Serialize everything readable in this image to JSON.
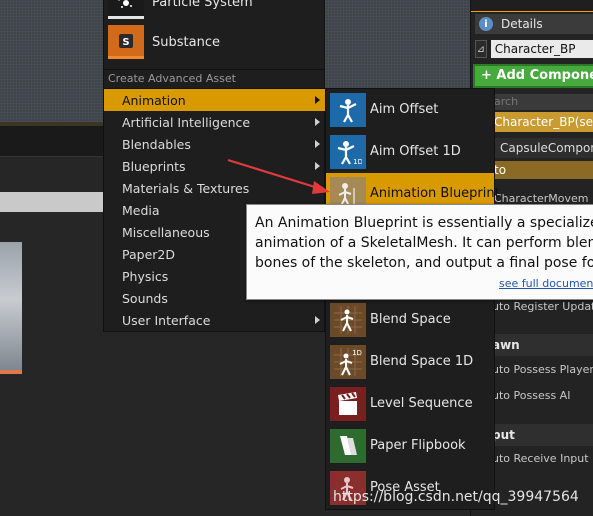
{
  "top_menu": {
    "items": [
      {
        "label": "Particle System",
        "icon": "particle-system-icon"
      },
      {
        "label": "Substance",
        "icon": "substance-icon"
      }
    ],
    "section_label": "Create Advanced Asset"
  },
  "advanced_menu": {
    "items": [
      {
        "label": "Animation",
        "selected": true
      },
      {
        "label": "Artificial Intelligence"
      },
      {
        "label": "Blendables"
      },
      {
        "label": "Blueprints"
      },
      {
        "label": "Materials & Textures"
      },
      {
        "label": "Media"
      },
      {
        "label": "Miscellaneous"
      },
      {
        "label": "Paper2D"
      },
      {
        "label": "Physics"
      },
      {
        "label": "Sounds"
      },
      {
        "label": "User Interface"
      }
    ]
  },
  "animation_submenu": {
    "items": [
      {
        "label": "Aim Offset",
        "icon": "aim-offset-icon"
      },
      {
        "label": "Aim Offset 1D",
        "icon": "aim-offset-1d-icon"
      },
      {
        "label": "Animation Blueprint",
        "icon": "animation-blueprint-icon",
        "highlighted": true
      },
      {
        "label": "Blend Space",
        "icon": "blend-space-icon"
      },
      {
        "label": "Blend Space 1D",
        "icon": "blend-space-1d-icon"
      },
      {
        "label": "Level Sequence",
        "icon": "level-sequence-icon"
      },
      {
        "label": "Paper Flipbook",
        "icon": "paper-flipbook-icon"
      },
      {
        "label": "Pose Asset",
        "icon": "pose-asset-icon"
      }
    ]
  },
  "tooltip": {
    "lines": [
      "An Animation Blueprint is essentially a specialize",
      "animation of a SkeletalMesh. It can perform blend",
      "bones of the skeleton, and output a final pose for"
    ],
    "link": "see full documenta"
  },
  "details": {
    "title": "Details",
    "object_name": "Character_BP",
    "add_component": "+ Add Componen",
    "search_placeholder": "arch",
    "self_row": "Character_BP(self",
    "capsule_row": "CapsuleCompone",
    "to_row": "to",
    "char_movement": "CharacterMovem",
    "auto_register": "uto Register Update",
    "pawn_section": "awn",
    "auto_possess_player": "uto Possess Player",
    "auto_possess_ai": "uto Possess AI",
    "input_section": "put",
    "auto_receive_input": "uto Receive Input"
  },
  "watermark": "https://blog.csdn.net/qq_39947564",
  "colors": {
    "accent": "#d99a00",
    "add_component": "#47a93e",
    "tooltip_bg": "#fbfbfb",
    "arrow": "#e03a3a"
  }
}
